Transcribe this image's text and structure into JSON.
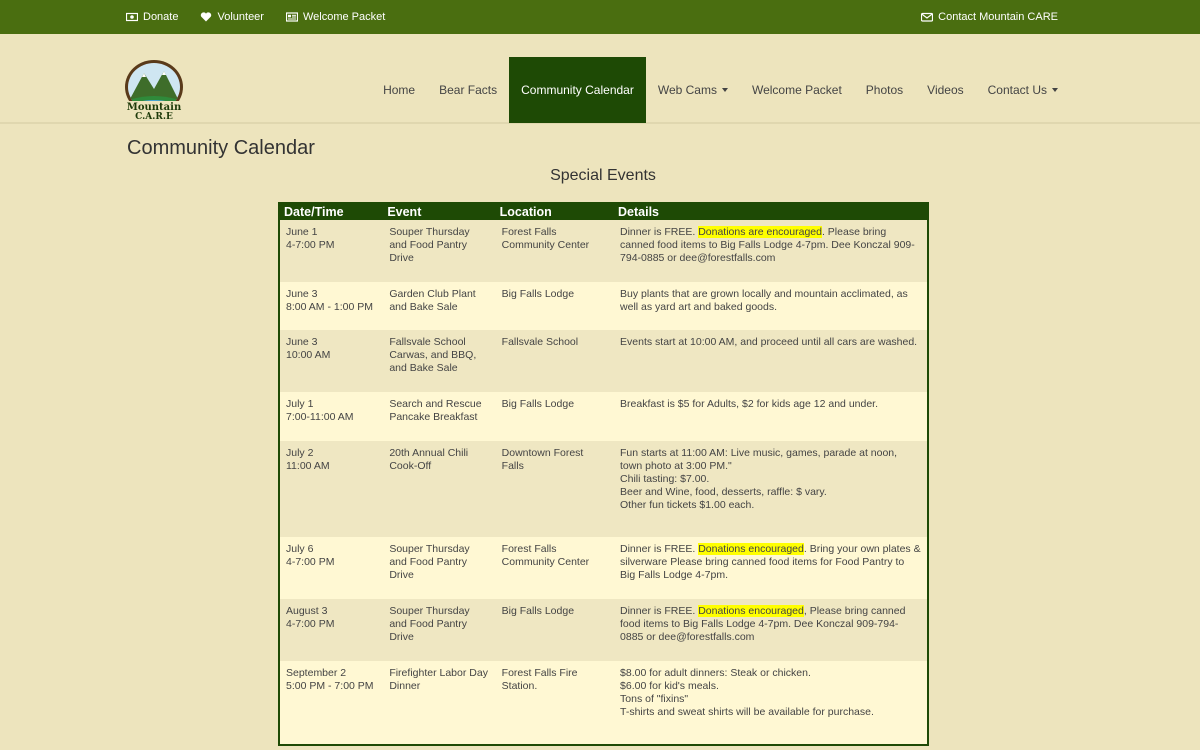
{
  "topbar": {
    "donate": "Donate",
    "volunteer": "Volunteer",
    "welcome_packet": "Welcome Packet",
    "contact": "Contact Mountain CARE"
  },
  "logo": {
    "line1": "Mountain",
    "line2": "C.A.R.E"
  },
  "nav": {
    "items": [
      "Home",
      "Bear Facts",
      "Community Calendar",
      "Web Cams",
      "Welcome Packet",
      "Photos",
      "Videos",
      "Contact Us"
    ]
  },
  "page_title": "Community Calendar",
  "subtitle": "Special Events",
  "table": {
    "headers": [
      "Date/Time",
      "Event",
      "Location",
      "Details"
    ],
    "rows": [
      {
        "date": "June 1",
        "time": "4-7:00 PM",
        "event": "Souper Thursday and Food Pantry Drive",
        "location": "Forest Falls Community Center",
        "details_pre": "Dinner is FREE. ",
        "details_hl": "Donations are encouraged",
        "details_post": ". Please bring canned food items to Big Falls Lodge 4-7pm. Dee Konczal 909-794-0885 or dee@forestfalls.com"
      },
      {
        "date": "June 3",
        "time": "8:00 AM - 1:00 PM",
        "event": "Garden Club Plant and Bake Sale",
        "location": "Big Falls Lodge",
        "details": "Buy plants that are grown locally and mountain acclimated, as well as yard art and baked goods."
      },
      {
        "date": "June 3",
        "time": "10:00 AM",
        "event": "Fallsvale School Carwas, and BBQ, and Bake Sale",
        "location": "Fallsvale School",
        "details": "Events start at 10:00 AM, and proceed until all cars are washed."
      },
      {
        "date": "July 1",
        "time": "7:00-11:00 AM",
        "event": "Search and Rescue Pancake Breakfast",
        "location": "Big Falls Lodge",
        "details": "Breakfast is $5 for Adults, $2 for kids age 12 and under."
      },
      {
        "date": "July 2",
        "time": "11:00 AM",
        "event": "20th Annual Chili Cook-Off",
        "location": "Downtown Forest Falls",
        "details_lines": [
          "Fun starts at 11:00 AM: Live music, games, parade at noon, town photo at 3:00 PM.\"",
          "Chili tasting: $7.00.",
          "Beer and Wine, food, desserts, raffle: $ vary.",
          "Other fun tickets $1.00 each."
        ]
      },
      {
        "date": "July 6",
        "time": "4-7:00 PM",
        "event": "Souper Thursday and Food Pantry Drive",
        "location": "Forest Falls Community Center",
        "details_pre": "Dinner is FREE. ",
        "details_hl": "Donations encouraged",
        "details_post": ". Bring your own plates & silverware Please bring canned food items for Food Pantry to Big Falls Lodge 4-7pm."
      },
      {
        "date": "August 3",
        "time": "4-7:00 PM",
        "event": "Souper Thursday and Food Pantry Drive",
        "location": "Big Falls Lodge",
        "details_pre": "Dinner is FREE. ",
        "details_hl": "Donations encouraged",
        "details_post": ", Please bring canned food items to Big Falls Lodge 4-7pm. Dee Konczal 909-794-0885 or dee@forestfalls.com"
      },
      {
        "date": "September 2",
        "time": "5:00 PM - 7:00 PM",
        "event": "Firefighter Labor Day Dinner",
        "location": "Forest Falls Fire Station.",
        "details_lines": [
          "$8.00 for adult dinners: Steak or chicken.",
          "$6.00 for kid's meals.",
          "Tons of \"fixins\"",
          "T-shirts and sweat shirts will be available for purchase."
        ]
      }
    ]
  },
  "colors": {
    "topbar": "#4a6e10",
    "nav_active": "#1e4a05",
    "background": "#ede4bd",
    "row_odd": "#efe7c2",
    "row_even": "#fff8d3",
    "highlight": "#ffff00"
  }
}
